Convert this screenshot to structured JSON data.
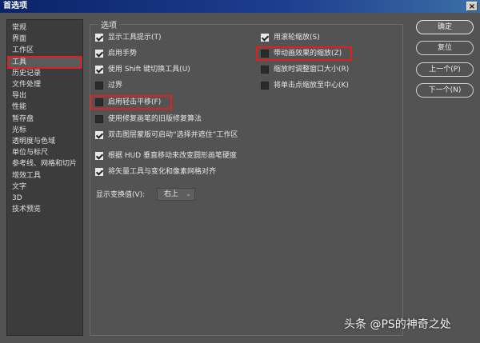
{
  "window": {
    "title": "首选项",
    "close_glyph": "×"
  },
  "sidebar": {
    "items": [
      {
        "label": "常规"
      },
      {
        "label": "界面"
      },
      {
        "label": "工作区"
      },
      {
        "label": "工具"
      },
      {
        "label": "历史记录"
      },
      {
        "label": "文件处理"
      },
      {
        "label": "导出"
      },
      {
        "label": "性能"
      },
      {
        "label": "暂存盘"
      },
      {
        "label": "光标"
      },
      {
        "label": "透明度与色域"
      },
      {
        "label": "单位与标尺"
      },
      {
        "label": "参考线、网格和切片"
      },
      {
        "label": "增效工具"
      },
      {
        "label": "文字"
      },
      {
        "label": "3D"
      },
      {
        "label": "技术预览"
      }
    ]
  },
  "options": {
    "group_title": "选项",
    "left": [
      {
        "label": "显示工具提示(T)",
        "checked": true
      },
      {
        "label": "启用手势",
        "checked": true
      },
      {
        "label": "使用 Shift 键切换工具(U)",
        "checked": true
      },
      {
        "label": "过界",
        "checked": false
      },
      {
        "label": "启用轻击平移(F)",
        "checked": false
      },
      {
        "label": "使用修复画笔的旧版修复算法",
        "checked": false
      },
      {
        "label": "双击图层蒙版可启动“选择并遮住”工作区",
        "checked": true
      },
      {
        "label": "根据 HUD 垂直移动来改变圆形画笔硬度",
        "checked": true
      },
      {
        "label": "将矢量工具与变化和像素网格对齐",
        "checked": true
      }
    ],
    "right": [
      {
        "label": "用滚轮缩放(S)",
        "checked": true
      },
      {
        "label": "带动画效果的缩放(Z)",
        "checked": false
      },
      {
        "label": "缩放时调整窗口大小(R)",
        "checked": false
      },
      {
        "label": "将单击点缩放至中心(K)",
        "checked": false
      }
    ],
    "transform_label": "显示变换值(V):",
    "transform_value": "右上",
    "dropdown_icon": "chevron-down-icon"
  },
  "buttons": {
    "ok": "确定",
    "reset": "复位",
    "prev": "上一个(P)",
    "next": "下一个(N)"
  },
  "watermark": "头条 @PS的神奇之处",
  "colors": {
    "highlight": "#e02020",
    "accent_titlebar": "#0a246a"
  }
}
